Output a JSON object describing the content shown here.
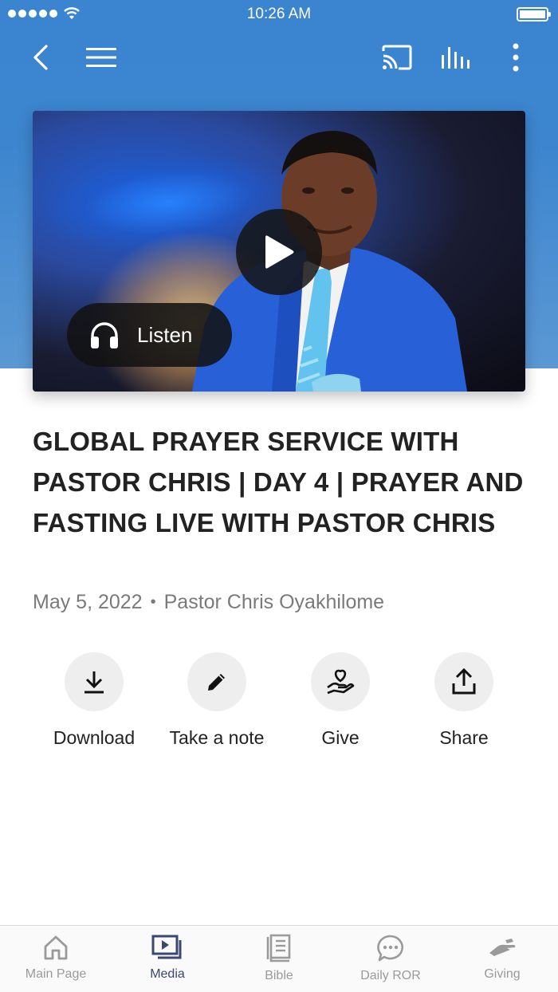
{
  "status_bar": {
    "time": "10:26 AM"
  },
  "toolbar": {
    "back_icon": "chevron-left-icon",
    "menu_icon": "hamburger-icon",
    "cast_icon": "cast-icon",
    "audio_icon": "equalizer-icon",
    "more_icon": "more-vertical-icon"
  },
  "video": {
    "play_icon": "play-icon",
    "listen_label": "Listen",
    "listen_icon": "headphones-icon"
  },
  "title": "GLOBAL PRAYER SERVICE WITH PASTOR CHRIS | DAY 4 | PRAYER AND FASTING LIVE WITH PASTOR CHRIS",
  "meta": {
    "date": "May 5, 2022",
    "separator": "•",
    "author": "Pastor Chris Oyakhilome"
  },
  "actions": [
    {
      "label": "Download",
      "icon": "download-icon"
    },
    {
      "label": "Take a note",
      "icon": "pencil-icon"
    },
    {
      "label": "Give",
      "icon": "heart-hand-icon"
    },
    {
      "label": "Share",
      "icon": "share-icon"
    }
  ],
  "tabs": [
    {
      "label": "Main Page",
      "icon": "home-icon",
      "active": false
    },
    {
      "label": "Media",
      "icon": "media-icon",
      "active": true
    },
    {
      "label": "Bible",
      "icon": "book-icon",
      "active": false
    },
    {
      "label": "Daily ROR",
      "icon": "chat-bubble-icon",
      "active": false
    },
    {
      "label": "Giving",
      "icon": "giving-hand-icon",
      "active": false
    }
  ],
  "colors": {
    "header_blue": "#3a84d0",
    "active_tab": "#3b4673",
    "inactive_tab": "#9a9a9a"
  }
}
